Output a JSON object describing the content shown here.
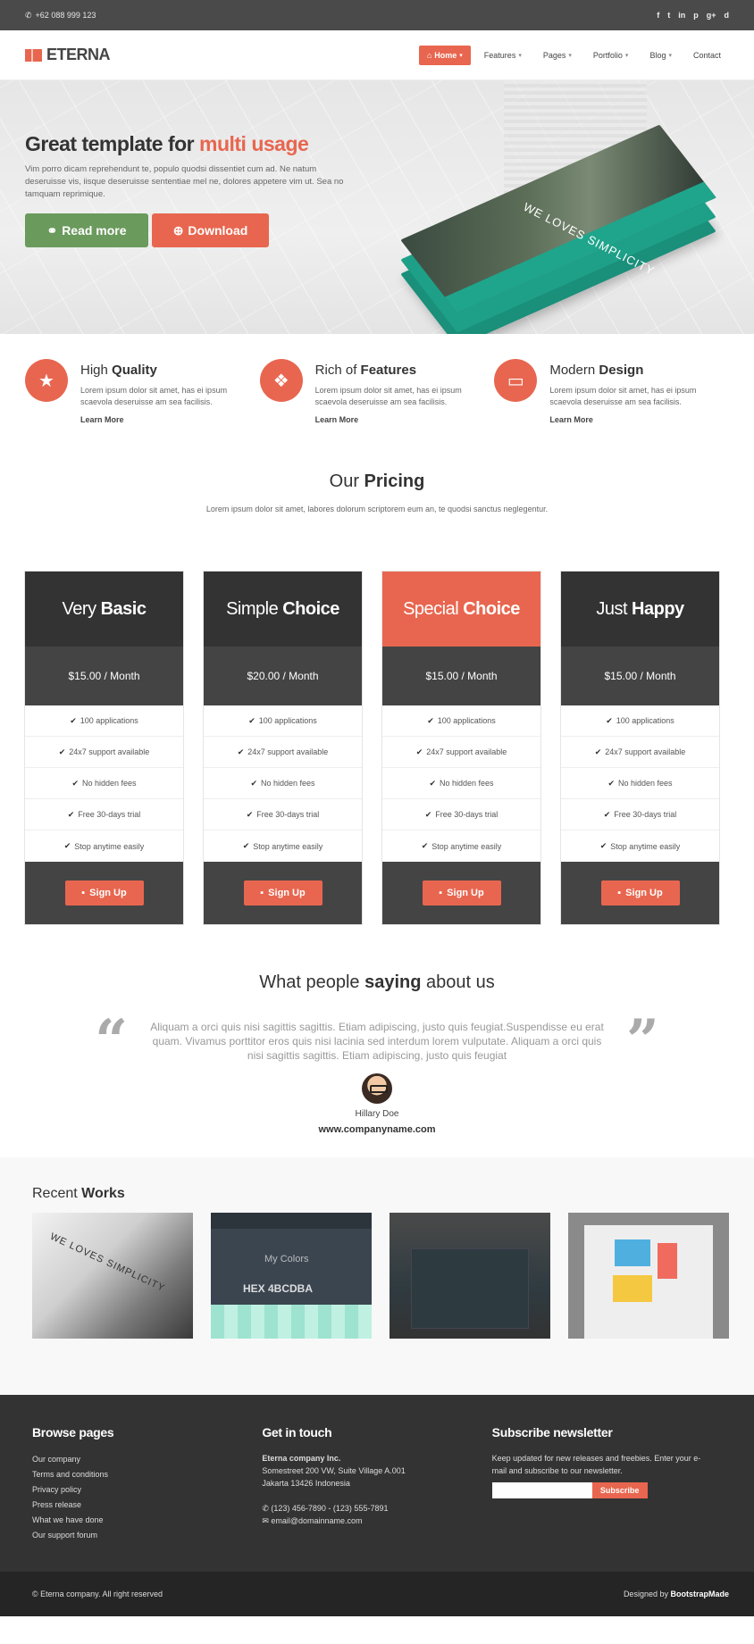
{
  "topbar": {
    "phone": "+62 088 999 123",
    "social": [
      "f",
      "t",
      "in",
      "p",
      "g+",
      "d"
    ]
  },
  "nav": {
    "logo": "ETERNA",
    "items": [
      {
        "label": "Home",
        "active": true
      },
      {
        "label": "Features"
      },
      {
        "label": "Pages"
      },
      {
        "label": "Portfolio"
      },
      {
        "label": "Blog"
      },
      {
        "label": "Contact"
      }
    ]
  },
  "hero": {
    "title_plain": "Great template for ",
    "title_accent": "multi usage",
    "text": "Vim porro dicam reprehendunt te, populo quodsi dissentiet cum ad. Ne natum deseruisse vis, iisque deseruisse sententiae mel ne, dolores appetere vim ut. Sea no tamquam reprimique.",
    "btn_read": "Read more",
    "btn_download": "Download",
    "mockup_text": "WE LOVES SIMPLICITY"
  },
  "features": [
    {
      "icon": "star",
      "title_light": "High ",
      "title_bold": "Quality",
      "text": "Lorem ipsum dolor sit amet, has ei ipsum scaevola deseruisse am sea facilisis.",
      "more": "Learn More"
    },
    {
      "icon": "dropbox",
      "title_light": "Rich of ",
      "title_bold": "Features",
      "text": "Lorem ipsum dolor sit amet, has ei ipsum scaevola deseruisse am sea facilisis.",
      "more": "Learn More"
    },
    {
      "icon": "laptop",
      "title_light": "Modern ",
      "title_bold": "Design",
      "text": "Lorem ipsum dolor sit amet, has ei ipsum scaevola deseruisse am sea facilisis.",
      "more": "Learn More"
    }
  ],
  "pricing": {
    "title_light": "Our ",
    "title_bold": "Pricing",
    "subtitle": "Lorem ipsum dolor sit amet, labores dolorum scriptorem eum an, te quodsi sanctus neglegentur.",
    "plans": [
      {
        "light": "Very",
        "bold": "Basic",
        "price": "$15.00 / Month",
        "featured": false
      },
      {
        "light": "Simple",
        "bold": "Choice",
        "price": "$20.00 / Month",
        "featured": false
      },
      {
        "light": "Special",
        "bold": "Choice",
        "price": "$15.00 / Month",
        "featured": true
      },
      {
        "light": "Just",
        "bold": "Happy",
        "price": "$15.00 / Month",
        "featured": false
      }
    ],
    "features": [
      "100 applications",
      "24x7 support available",
      "No hidden fees",
      "Free 30-days trial",
      "Stop anytime easily"
    ],
    "signup": "Sign Up"
  },
  "testimonial": {
    "title_1": "What people ",
    "title_bold": "saying",
    "title_2": " about us",
    "text": "Aliquam a orci quis nisi sagittis sagittis. Etiam adipiscing, justo quis feugiat.Suspendisse eu erat quam. Vivamus porttitor eros quis nisi lacinia sed interdum lorem vulputate. Aliquam a orci quis nisi sagittis sagittis. Etiam adipiscing, justo quis feugiat",
    "name": "Hillary Doe",
    "site": "www.companyname.com"
  },
  "works": {
    "title_light": "Recent ",
    "title_bold": "Works",
    "w1_text": "WE LOVES SIMPLICITY",
    "w2_text1": "My Colors",
    "w2_text2": "HEX 4BCDBA"
  },
  "footer": {
    "browse_title": "Browse pages",
    "browse": [
      "Our company",
      "Terms and conditions",
      "Privacy policy",
      "Press release",
      "What we have done",
      "Our support forum"
    ],
    "contact_title": "Get in touch",
    "company": "Eterna company Inc.",
    "address1": "Somestreet 200 VW, Suite Village A.001",
    "address2": "Jakarta 13426 Indonesia",
    "phone": "(123) 456-7890 - (123) 555-7891",
    "email": "email@domainname.com",
    "subscribe_title": "Subscribe newsletter",
    "subscribe_text": "Keep updated for new releases and freebies. Enter your e-mail and subscribe to our newsletter.",
    "subscribe_btn": "Subscribe",
    "copyright": "© Eterna company. All right reserved",
    "designed_by": "Designed by ",
    "designed_brand": "BootstrapMade"
  }
}
